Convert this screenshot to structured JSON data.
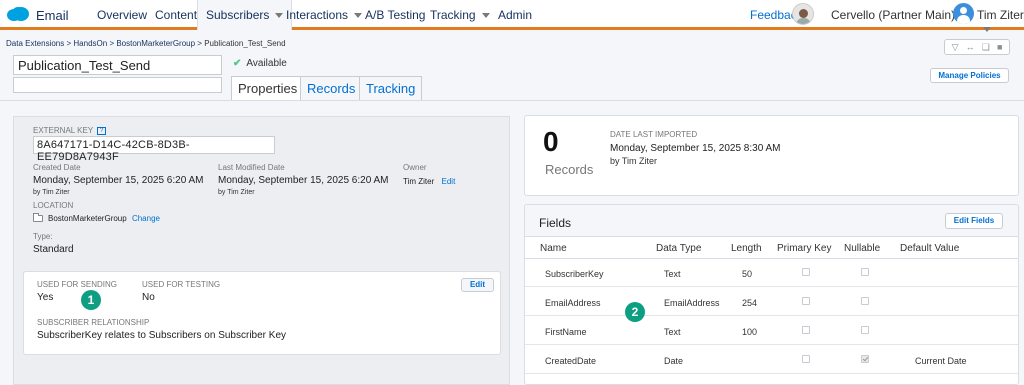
{
  "nav": {
    "brand": "Email",
    "items": [
      "Overview",
      "Content",
      "Subscribers",
      "Interactions",
      "A/B Testing",
      "Tracking",
      "Admin"
    ],
    "feedback": "Feedback",
    "business_unit": "Cervello (Partner Main)",
    "user": "Tim Ziter"
  },
  "breadcrumb": {
    "items": [
      "Data Extensions",
      "HandsOn",
      "BostonMarketerGroup"
    ],
    "current": "Publication_Test_Send",
    "sep": ">"
  },
  "de": {
    "name": "Publication_Test_Send",
    "status": "Available"
  },
  "tabs": [
    "Properties",
    "Records",
    "Tracking"
  ],
  "buttons": {
    "manage_policies": "Manage Policies",
    "edit": "Edit",
    "edit_fields": "Edit Fields"
  },
  "properties": {
    "external_key_label": "EXTERNAL KEY",
    "help": "?",
    "external_key": "8A647171-D14C-42CB-8D3B-EE79D8A7943F",
    "created_label": "Created Date",
    "created": "Monday, September 15, 2025 6:20 AM",
    "created_by": "by Tim Ziter",
    "modified_label": "Last Modified Date",
    "modified": "Monday, September 15, 2025 6:20 AM",
    "modified_by": "by Tim Ziter",
    "owner_label": "Owner",
    "owner": "Tim Ziter",
    "owner_edit": "Edit",
    "location_label": "LOCATION",
    "location": "BostonMarketerGroup",
    "location_change": "Change",
    "type_label": "Type:",
    "type": "Standard"
  },
  "sending": {
    "used_for_sending_label": "USED FOR SENDING",
    "used_for_sending": "Yes",
    "used_for_testing_label": "USED FOR TESTING",
    "used_for_testing": "No",
    "relationship_label": "SUBSCRIBER RELATIONSHIP",
    "relationship": "SubscriberKey relates to Subscribers on Subscriber Key"
  },
  "badges": [
    "1",
    "2"
  ],
  "records": {
    "count": "0",
    "label": "Records",
    "imported_label": "DATE LAST IMPORTED",
    "imported": "Monday, September 15, 2025 8:30 AM",
    "imported_by": "by Tim Ziter"
  },
  "fields": {
    "title": "Fields",
    "columns": [
      "Name",
      "Data Type",
      "Length",
      "Primary Key",
      "Nullable",
      "Default Value"
    ],
    "rows": [
      {
        "name": "SubscriberKey",
        "type": "Text",
        "length": "50",
        "primary_key": false,
        "nullable": false,
        "default": ""
      },
      {
        "name": "EmailAddress",
        "type": "EmailAddress",
        "length": "254",
        "primary_key": false,
        "nullable": false,
        "default": ""
      },
      {
        "name": "FirstName",
        "type": "Text",
        "length": "100",
        "primary_key": false,
        "nullable": false,
        "default": ""
      },
      {
        "name": "CreatedDate",
        "type": "Date",
        "length": "",
        "primary_key": false,
        "nullable": true,
        "default": "Current Date"
      }
    ]
  },
  "colors": {
    "accent": "#e07b1f",
    "link": "#0070d2",
    "badge": "#0e9f83"
  }
}
